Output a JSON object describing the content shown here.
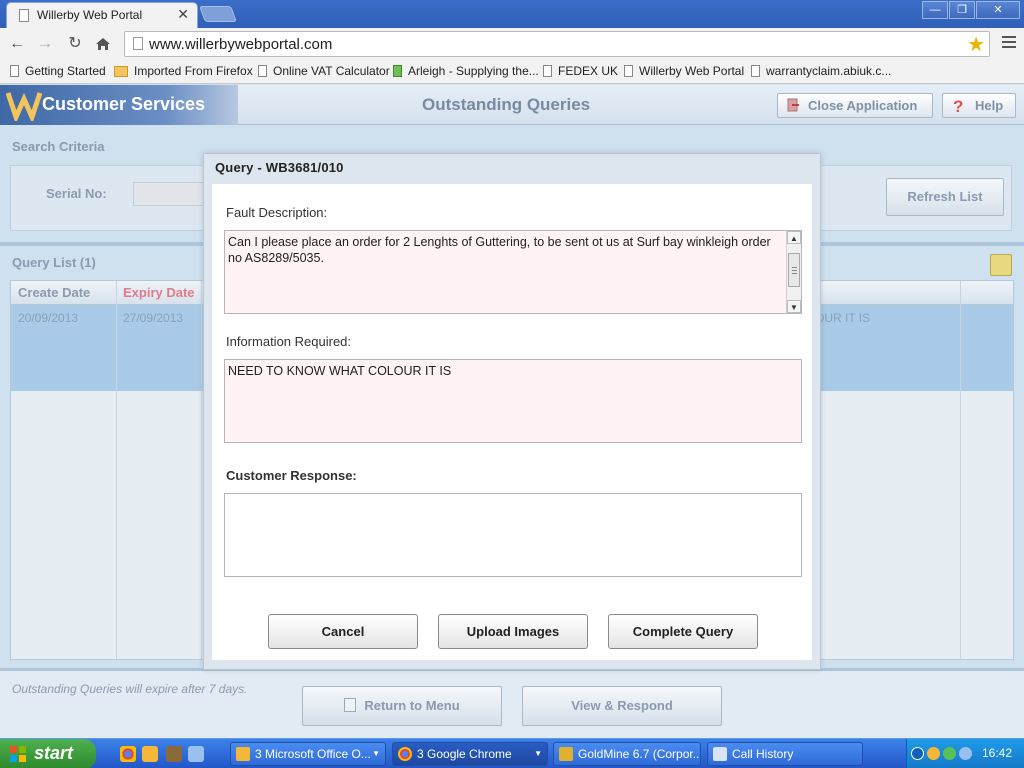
{
  "browser": {
    "tab_title": "Willerby Web Portal",
    "tab_close": "✕",
    "url": "www.willerbywebportal.com",
    "window_buttons": [
      "—",
      "❐",
      "✕"
    ],
    "bookmarks": [
      {
        "label": "Getting Started",
        "icon": "page-icon"
      },
      {
        "label": "Imported From Firefox",
        "icon": "folder-icon"
      },
      {
        "label": "Online VAT Calculator",
        "icon": "page-icon"
      },
      {
        "label": "Arleigh - Supplying the...",
        "icon": "arleigh-icon"
      },
      {
        "label": "FEDEX UK",
        "icon": "page-icon"
      },
      {
        "label": "Willerby Web Portal",
        "icon": "page-icon"
      },
      {
        "label": "warrantyclaim.abiuk.c...",
        "icon": "page-icon"
      }
    ]
  },
  "app": {
    "brand": "Customer Services",
    "page_title": "Outstanding Queries",
    "close_application": "Close Application",
    "help": "Help",
    "search_criteria": "Search Criteria",
    "serial_label": "Serial No:",
    "refresh_list": "Refresh List",
    "query_list_label": "Query List (1)",
    "columns": {
      "create_date": "Create Date",
      "expiry_date": "Expiry Date"
    },
    "row": {
      "create_date": "20/09/2013",
      "expiry_date": "27/09/2013",
      "info_fragment": "OUR IT IS"
    },
    "footer_note": "Outstanding Queries will expire after 7 days.",
    "return_to_menu": "Return to Menu",
    "view_respond": "View & Respond",
    "colors": {
      "accent": "#3e68a6",
      "selected_row": "#a9cbe8",
      "expiry_header": "#e07a8a"
    }
  },
  "modal": {
    "title": "Query - WB3681/010",
    "fault_label": "Fault Description:",
    "fault_text": "Can I please place an order for 2 Lenghts of Guttering, to be sent ot us at Surf bay winkleigh order no AS8289/5035.",
    "info_label": "Information Required:",
    "info_text": "NEED TO KNOW WHAT COLOUR IT IS",
    "response_label": "Customer Response:",
    "response_value": "",
    "cancel": "Cancel",
    "upload_images": "Upload Images",
    "complete_query": "Complete Query"
  },
  "taskbar": {
    "start": "start",
    "tasks": [
      {
        "label": "3 Microsoft Office O...",
        "icon": "outlook-icon"
      },
      {
        "label": "3 Google Chrome",
        "icon": "chrome-icon"
      },
      {
        "label": "GoldMine 6.7 (Corpor...",
        "icon": "goldmine-icon"
      },
      {
        "label": "Call History",
        "icon": "call-history-icon"
      }
    ],
    "clock": "16:42"
  }
}
